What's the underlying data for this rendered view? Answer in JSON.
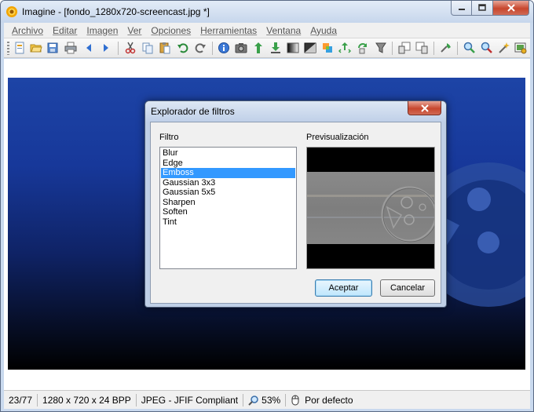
{
  "window": {
    "title": "Imagine - [fondo_1280x720-screencast.jpg *]",
    "app_icon": "sun-flower-icon",
    "controls": [
      "minimize-icon",
      "maximize-icon",
      "close-icon"
    ]
  },
  "menubar": {
    "items": [
      "Archivo",
      "Editar",
      "Imagen",
      "Ver",
      "Opciones",
      "Herramientas",
      "Ventana",
      "Ayuda"
    ]
  },
  "toolbar": {
    "icons": [
      "new-icon",
      "open-icon",
      "save-icon",
      "print-icon",
      "previous-icon",
      "next-icon",
      "cut-icon",
      "copy-icon",
      "paste-icon",
      "undo-icon",
      "redo-icon",
      "info-icon",
      "capture-icon",
      "flip-vertical-icon",
      "flip-horizontal-icon",
      "grayscale-icon",
      "negative-icon",
      "rotate-icon",
      "crop-icon",
      "resize-icon",
      "filter-icon",
      "zoom-in-icon",
      "zoom-out-icon",
      "zoom-fit-icon",
      "slideshow-icon",
      "zoom-plus-icon",
      "zoom-minus-icon",
      "magic-wand-icon",
      "settings-icon"
    ]
  },
  "dialog": {
    "title": "Explorador de filtros",
    "filter_label": "Filtro",
    "preview_label": "Previsualización",
    "filters": [
      "Blur",
      "Edge",
      "Emboss",
      "Gaussian 3x3",
      "Gaussian 5x5",
      "Sharpen",
      "Soften",
      "Tint"
    ],
    "selected_filter": "Emboss",
    "accept_label": "Aceptar",
    "cancel_label": "Cancelar"
  },
  "statusbar": {
    "page": "23/77",
    "dimensions": "1280 x 720 x 24 BPP",
    "format": "JPEG - JFIF Compliant",
    "zoom": "53%",
    "mode": "Por defecto"
  },
  "colors": {
    "selection": "#3399ff",
    "image_top": "#1d44a6",
    "image_bottom": "#000000",
    "window_frame": "#c9d9ee"
  }
}
